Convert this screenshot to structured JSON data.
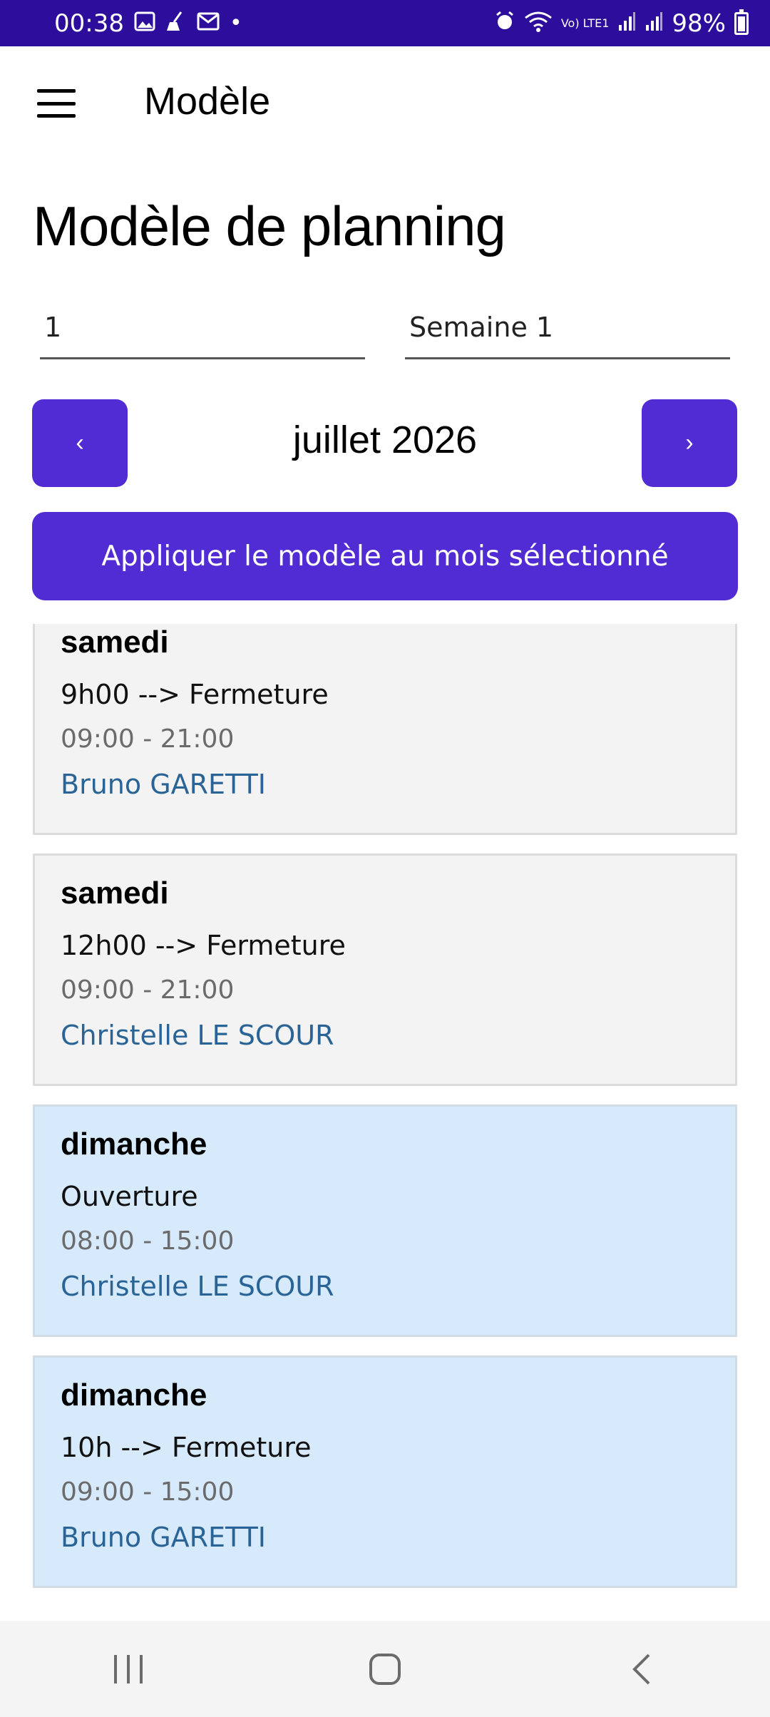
{
  "status_bar": {
    "time": "00:38",
    "network_label": "Vo) LTE1",
    "battery": "98%"
  },
  "app_bar": {
    "title": "Modèle",
    "menu_icon": "hamburger-icon"
  },
  "page": {
    "title": "Modèle de planning"
  },
  "form": {
    "number_value": "1",
    "week_value": "Semaine 1"
  },
  "month_nav": {
    "prev_label": "‹",
    "next_label": "›",
    "month": "juillet 2026"
  },
  "apply_button": {
    "label": "Appliquer le modèle au mois sélectionné"
  },
  "entries": [
    {
      "day": "samedi",
      "shift": "9h00 --> Fermeture",
      "time": "09:00 - 21:00",
      "person": "Bruno GARETTI",
      "kind": "sat"
    },
    {
      "day": "samedi",
      "shift": "12h00 --> Fermeture",
      "time": "09:00 - 21:00",
      "person": "Christelle LE SCOUR",
      "kind": "sat"
    },
    {
      "day": "dimanche",
      "shift": "Ouverture",
      "time": "08:00 - 15:00",
      "person": "Christelle LE SCOUR",
      "kind": "sun"
    },
    {
      "day": "dimanche",
      "shift": "10h --> Fermeture",
      "time": "09:00 - 15:00",
      "person": "Bruno GARETTI",
      "kind": "sun"
    }
  ],
  "colors": {
    "status_bar": "#2d0e9c",
    "primary": "#512bd4",
    "saturday_card": "#f3f3f3",
    "sunday_card": "#d6eafc",
    "person_link": "#2a6496"
  },
  "bottom_nav": {
    "icons": [
      "recents-icon",
      "home-icon",
      "back-icon"
    ]
  }
}
